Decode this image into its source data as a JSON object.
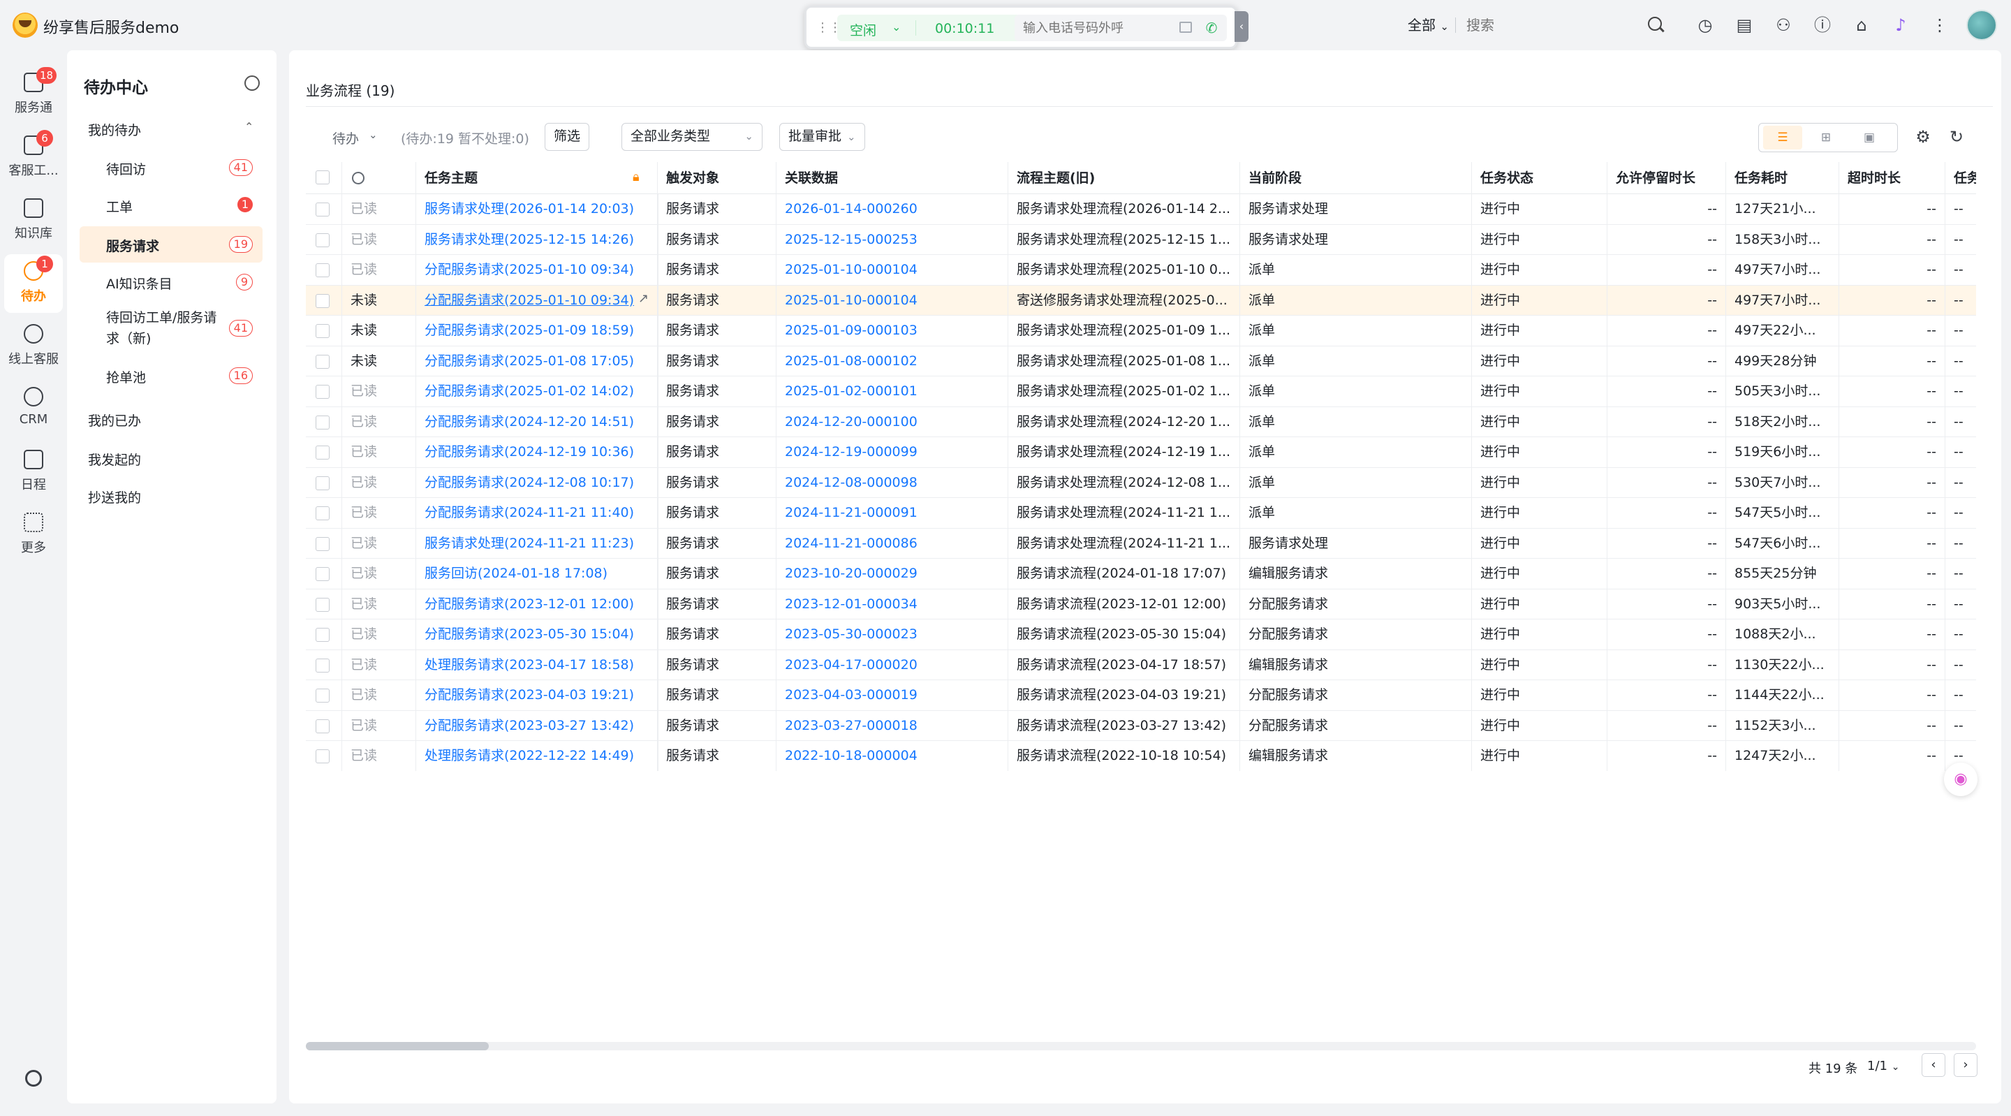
{
  "app": {
    "title": "纷享售后服务demo"
  },
  "callbar": {
    "status": "空闲",
    "timer": "00:10:11",
    "dial_placeholder": "输入电话号码外呼"
  },
  "header": {
    "scope": "全部",
    "search_placeholder": "搜索"
  },
  "leftnav": [
    {
      "label": "服务通",
      "badge": "18",
      "icon": "service-icon"
    },
    {
      "label": "客服工...",
      "badge": "6",
      "icon": "headset-icon"
    },
    {
      "label": "知识库",
      "badge": "",
      "icon": "book-icon"
    },
    {
      "label": "待办",
      "badge": "1",
      "icon": "todo-icon"
    },
    {
      "label": "线上客服",
      "badge": "",
      "icon": "chat-icon"
    },
    {
      "label": "CRM",
      "badge": "",
      "icon": "clock-icon"
    },
    {
      "label": "日程",
      "badge": "",
      "icon": "calendar-icon"
    },
    {
      "label": "更多",
      "badge": "",
      "icon": "grid-icon"
    }
  ],
  "sidebar": {
    "title": "待办中心",
    "section_mine": "我的待办",
    "items": [
      {
        "label": "待回访",
        "count": "41"
      },
      {
        "label": "工单",
        "count": "1"
      },
      {
        "label": "服务请求",
        "count": "19"
      },
      {
        "label": "AI知识条目",
        "count": "9"
      },
      {
        "label": "待回访工单/服务请求（新)",
        "count": "41"
      },
      {
        "label": "抢单池",
        "count": "16"
      }
    ],
    "sections": [
      "我的已办",
      "我发起的",
      "抄送我的"
    ]
  },
  "main": {
    "title": "业务流程 (19)",
    "filter_status": "待办",
    "filter_count": "(待办:19 暂不处理:0)",
    "filter_button": "筛选",
    "biz_type": "全部业务类型",
    "batch": "批量审批"
  },
  "table": {
    "columns": [
      "任务主题",
      "触发对象",
      "关联数据",
      "流程主题(旧)",
      "当前阶段",
      "任务状态",
      "允许停留时长",
      "任务耗时",
      "超时时长",
      "任务"
    ],
    "rows": [
      [
        "已读",
        "服务请求处理(2026-01-14 20:03)",
        "服务请求",
        "2026-01-14-000260",
        "服务请求处理流程(2026-01-14 2...",
        "服务请求处理",
        "进行中",
        "--",
        "127天21小...",
        "--",
        "--"
      ],
      [
        "已读",
        "服务请求处理(2025-12-15 14:26)",
        "服务请求",
        "2025-12-15-000253",
        "服务请求处理流程(2025-12-15 1...",
        "服务请求处理",
        "进行中",
        "--",
        "158天3小时...",
        "--",
        "--"
      ],
      [
        "已读",
        "分配服务请求(2025-01-10 09:34)",
        "服务请求",
        "2025-01-10-000104",
        "服务请求处理流程(2025-01-10 0...",
        "派单",
        "进行中",
        "--",
        "497天7小时...",
        "--",
        "--"
      ],
      [
        "未读",
        "分配服务请求(2025-01-10 09:34)",
        "服务请求",
        "2025-01-10-000104",
        "寄送修服务请求处理流程(2025-0...",
        "派单",
        "进行中",
        "--",
        "497天7小时...",
        "--",
        "--"
      ],
      [
        "未读",
        "分配服务请求(2025-01-09 18:59)",
        "服务请求",
        "2025-01-09-000103",
        "服务请求处理流程(2025-01-09 1...",
        "派单",
        "进行中",
        "--",
        "497天22小...",
        "--",
        "--"
      ],
      [
        "未读",
        "分配服务请求(2025-01-08 17:05)",
        "服务请求",
        "2025-01-08-000102",
        "服务请求处理流程(2025-01-08 1...",
        "派单",
        "进行中",
        "--",
        "499天28分钟",
        "--",
        "--"
      ],
      [
        "已读",
        "分配服务请求(2025-01-02 14:02)",
        "服务请求",
        "2025-01-02-000101",
        "服务请求处理流程(2025-01-02 1...",
        "派单",
        "进行中",
        "--",
        "505天3小时...",
        "--",
        "--"
      ],
      [
        "已读",
        "分配服务请求(2024-12-20 14:51)",
        "服务请求",
        "2024-12-20-000100",
        "服务请求处理流程(2024-12-20 1...",
        "派单",
        "进行中",
        "--",
        "518天2小时...",
        "--",
        "--"
      ],
      [
        "已读",
        "分配服务请求(2024-12-19 10:36)",
        "服务请求",
        "2024-12-19-000099",
        "服务请求处理流程(2024-12-19 1...",
        "派单",
        "进行中",
        "--",
        "519天6小时...",
        "--",
        "--"
      ],
      [
        "已读",
        "分配服务请求(2024-12-08 10:17)",
        "服务请求",
        "2024-12-08-000098",
        "服务请求处理流程(2024-12-08 1...",
        "派单",
        "进行中",
        "--",
        "530天7小时...",
        "--",
        "--"
      ],
      [
        "已读",
        "分配服务请求(2024-11-21 11:40)",
        "服务请求",
        "2024-11-21-000091",
        "服务请求处理流程(2024-11-21 1...",
        "派单",
        "进行中",
        "--",
        "547天5小时...",
        "--",
        "--"
      ],
      [
        "已读",
        "服务请求处理(2024-11-21 11:23)",
        "服务请求",
        "2024-11-21-000086",
        "服务请求处理流程(2024-11-21 1...",
        "服务请求处理",
        "进行中",
        "--",
        "547天6小时...",
        "--",
        "--"
      ],
      [
        "已读",
        "服务回访(2024-01-18 17:08)",
        "服务请求",
        "2023-10-20-000029",
        "服务请求流程(2024-01-18 17:07)",
        "编辑服务请求",
        "进行中",
        "--",
        "855天25分钟",
        "--",
        "--"
      ],
      [
        "已读",
        "分配服务请求(2023-12-01 12:00)",
        "服务请求",
        "2023-12-01-000034",
        "服务请求流程(2023-12-01 12:00)",
        "分配服务请求",
        "进行中",
        "--",
        "903天5小时...",
        "--",
        "--"
      ],
      [
        "已读",
        "分配服务请求(2023-05-30 15:04)",
        "服务请求",
        "2023-05-30-000023",
        "服务请求流程(2023-05-30 15:04)",
        "分配服务请求",
        "进行中",
        "--",
        "1088天2小...",
        "--",
        "--"
      ],
      [
        "已读",
        "处理服务请求(2023-04-17 18:58)",
        "服务请求",
        "2023-04-17-000020",
        "服务请求流程(2023-04-17 18:57)",
        "编辑服务请求",
        "进行中",
        "--",
        "1130天22小...",
        "--",
        "--"
      ],
      [
        "已读",
        "分配服务请求(2023-04-03 19:21)",
        "服务请求",
        "2023-04-03-000019",
        "服务请求流程(2023-04-03 19:21)",
        "分配服务请求",
        "进行中",
        "--",
        "1144天22小...",
        "--",
        "--"
      ],
      [
        "已读",
        "分配服务请求(2023-03-27 13:42)",
        "服务请求",
        "2023-03-27-000018",
        "服务请求流程(2023-03-27 13:42)",
        "分配服务请求",
        "进行中",
        "--",
        "1152天3小...",
        "--",
        "--"
      ],
      [
        "已读",
        "处理服务请求(2022-12-22 14:49)",
        "服务请求",
        "2022-10-18-000004",
        "服务请求流程(2022-10-18 10:54)",
        "编辑服务请求",
        "进行中",
        "--",
        "1247天2小...",
        "--",
        "--"
      ]
    ]
  },
  "pager": {
    "total": "共 19 条",
    "page": "1/1"
  }
}
